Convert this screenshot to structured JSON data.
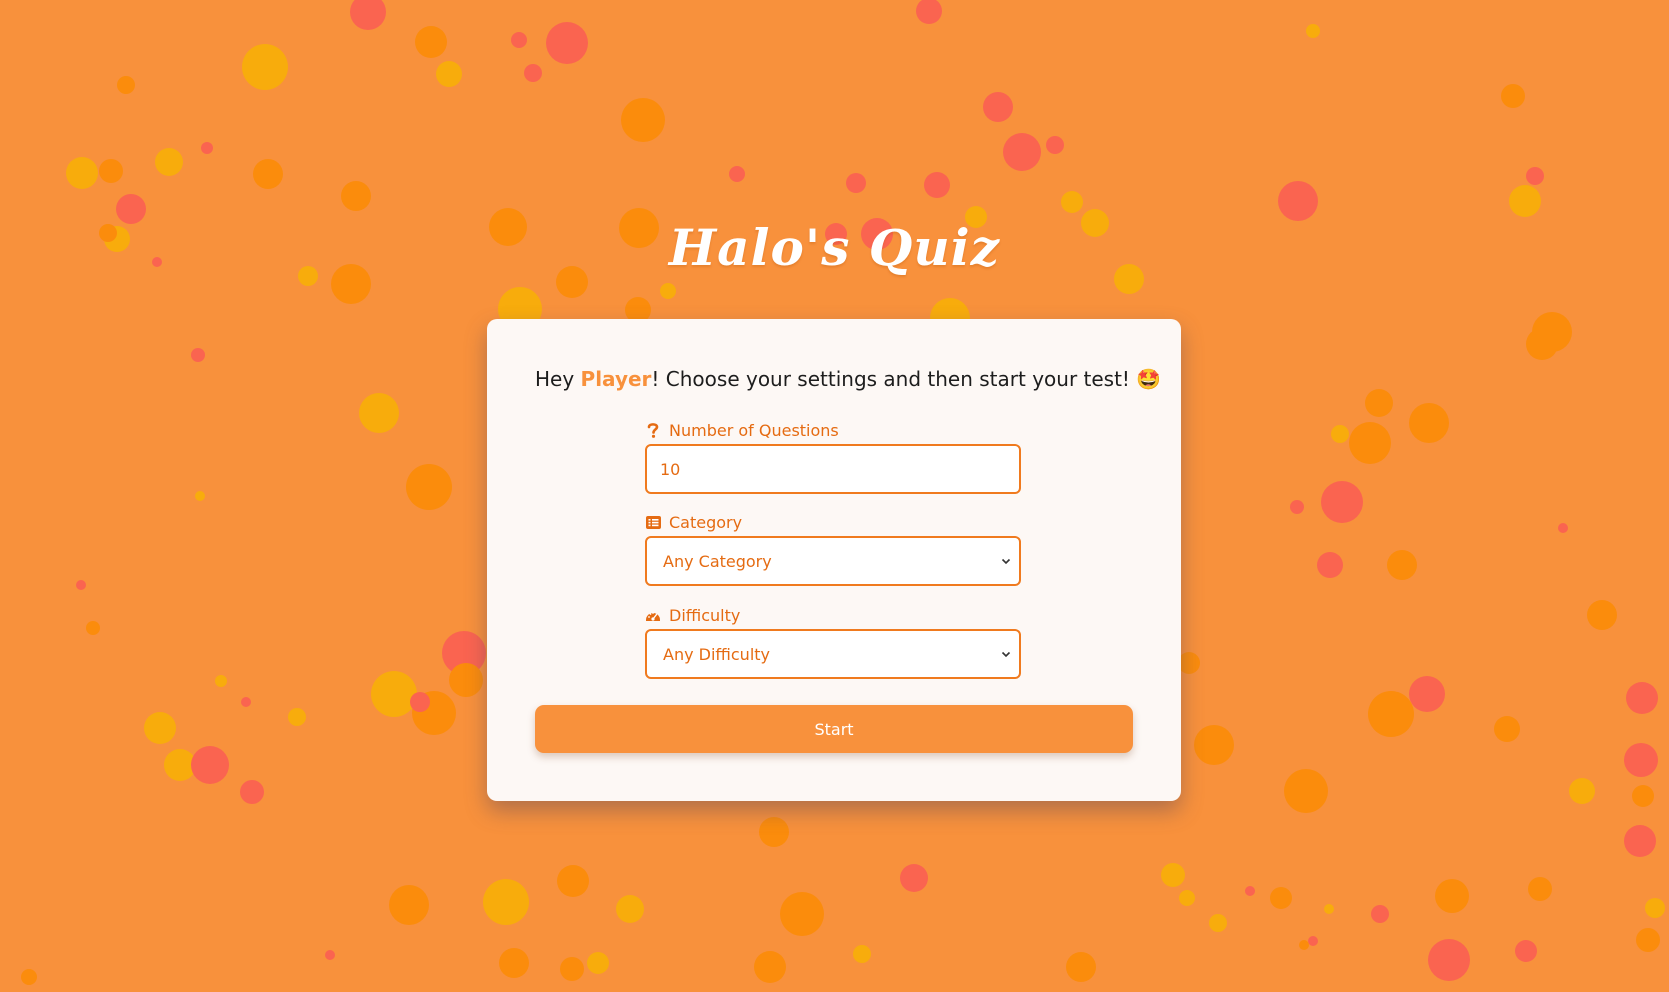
{
  "app": {
    "title": "Halo's Quiz"
  },
  "greeting": {
    "prefix": "Hey ",
    "player_name": "Player",
    "suffix": "! Choose your settings and then start your test! 🤩"
  },
  "form": {
    "questions": {
      "label": "Number of Questions",
      "value": "10",
      "icon": "question-icon"
    },
    "category": {
      "label": "Category",
      "selected": "Any Category",
      "icon": "list-icon"
    },
    "difficulty": {
      "label": "Difficulty",
      "selected": "Any Difficulty",
      "icon": "gauge-icon"
    },
    "start_label": "Start"
  },
  "colors": {
    "background": "#f8913c",
    "accent": "#f07a1e",
    "card": "#fdf8f5",
    "bubble_red": "#fa6450",
    "bubble_orange": "#fb8c0c",
    "bubble_yellow": "#f8ac0c"
  }
}
